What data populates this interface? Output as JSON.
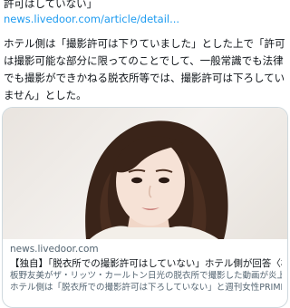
{
  "tweet": {
    "top_line": "許可はしていない」",
    "link_text": "news.livedoor.com/article/detail...",
    "paragraph_lines": [
      "ホテル側は「撮影許可は下りていました」とした上で「許可",
      "は撮影可能な部分に限ってのことでして、一般常識でも法律",
      "でも撮影ができかねる脱衣所等では、撮影許可は下ろしてい",
      "ません」とした。"
    ]
  },
  "card": {
    "domain": "news.livedoor.com",
    "title": "【独自】「脱衣所での撮影許可はしていない」ホテル側が回答〈板野友美の...",
    "desc_lines": [
      "板野友美がザ・リッツ・カールトン日光の脱衣所で撮影した動画が炎上した。",
      "ホテル側は「脱衣所での撮影許可は下ろしていない」と週刊女性PRIMEに回..."
    ]
  },
  "colors": {
    "text": "#0f1419",
    "link": "#1d9bf0",
    "muted": "#536471",
    "border": "#cfd9de"
  }
}
